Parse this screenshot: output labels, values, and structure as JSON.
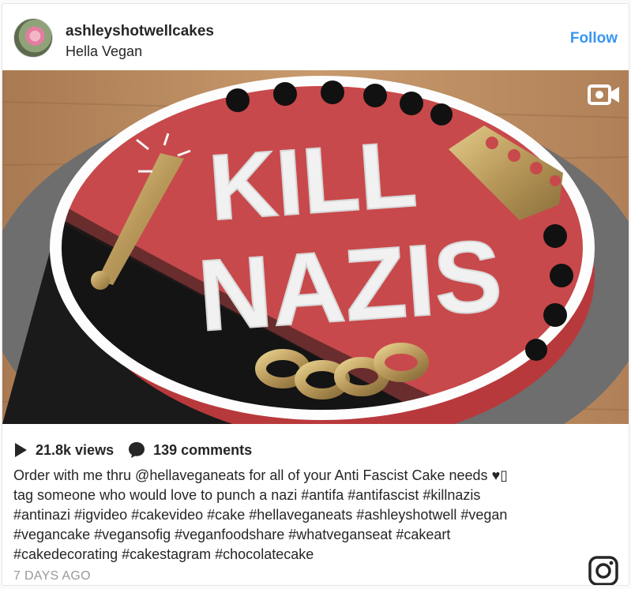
{
  "post": {
    "username": "ashleyshotwellcakes",
    "location": "Hella Vegan",
    "follow_label": "Follow",
    "media": {
      "icon": "video-camera-icon",
      "cake_text_line1": "KILL",
      "cake_text_line2": "NAZIS"
    },
    "stats": {
      "views": "21.8k views",
      "comments": "139 comments"
    },
    "caption": {
      "line1": "Order with me thru @hellaveganeats for all of your Anti Fascist Cake needs ",
      "heart": "♥",
      "line1_suffix": "▯",
      "line2": "tag someone who would love to punch a nazi #antifa #antifascist #killnazis",
      "line3": "#antinazi #igvideo #cakevideo #cake #hellaveganeats #ashleyshotwell #vegan",
      "line4": "#vegancake #vegansofig #veganfoodshare #whatveganseat #cakeart",
      "line5": "#cakedecorating #cakestagram #chocolatecake"
    },
    "timestamp": "7 DAYS AGO"
  },
  "colors": {
    "follow": "#3897f0",
    "text": "#262626",
    "muted": "#999999",
    "cake_red": "#c8494b",
    "cake_black": "#141414",
    "gold": "#b8985a"
  }
}
